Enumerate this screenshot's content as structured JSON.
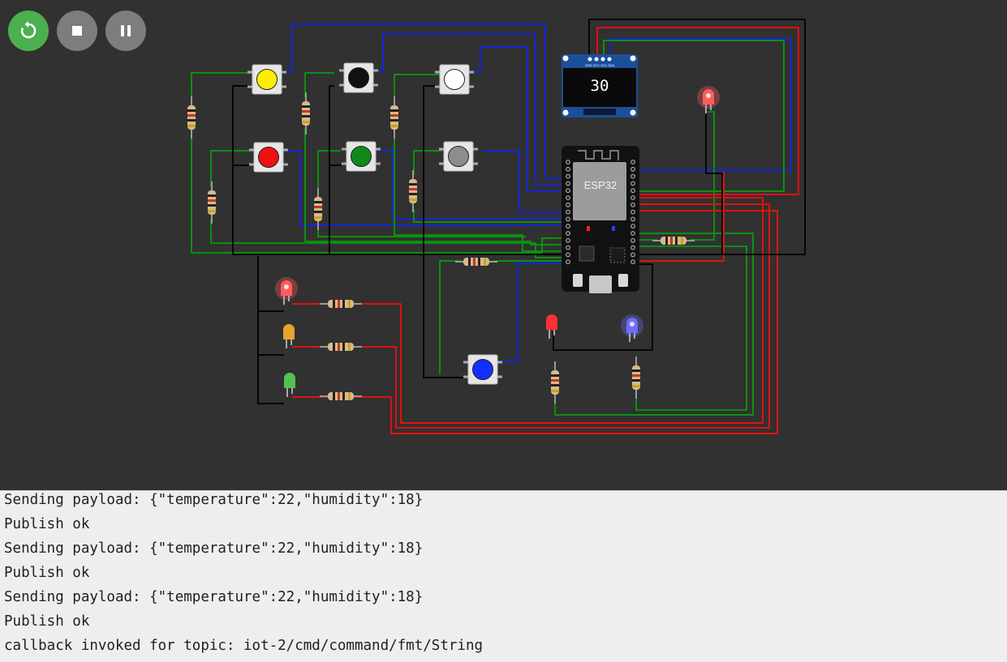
{
  "controls": {
    "restart_icon": "restart-icon",
    "stop_icon": "stop-icon",
    "pause_icon": "pause-icon",
    "restart_color": "#4caf50",
    "stop_color": "#7d7d7d",
    "pause_color": "#7d7d7d"
  },
  "simulation": {
    "board_label": "ESP32",
    "oled_value": "30",
    "oled_pin_labels": "GND VCC SCL SDA",
    "buttons": [
      {
        "name": "yellow",
        "color": "#ffee00"
      },
      {
        "name": "black",
        "color": "#111111"
      },
      {
        "name": "white",
        "color": "#ffffff"
      },
      {
        "name": "red",
        "color": "#ee1111"
      },
      {
        "name": "green",
        "color": "#0f8a1a"
      },
      {
        "name": "gray",
        "color": "#8d8d8d"
      },
      {
        "name": "blue",
        "color": "#1030ff"
      }
    ],
    "leds": [
      {
        "name": "red-top-right",
        "color": "#ff5b5b",
        "lit": true
      },
      {
        "name": "red-left",
        "color": "#ff5b5b",
        "lit": true
      },
      {
        "name": "orange-left",
        "color": "#e6a42a",
        "lit": false
      },
      {
        "name": "green-left",
        "color": "#54c154",
        "lit": false
      },
      {
        "name": "red-bottom",
        "color": "#ff3030",
        "lit": false
      },
      {
        "name": "blue-bottom",
        "color": "#6e6eff",
        "lit": true
      }
    ],
    "wire_colors": {
      "red": "#e01010",
      "blue": "#1226d8",
      "green": "#0c9010",
      "black": "#050505"
    }
  },
  "console": {
    "lines": [
      "Sending payload: {\"temperature\":22,\"humidity\":18}",
      "Publish ok",
      "Sending payload: {\"temperature\":22,\"humidity\":18}",
      "Publish ok",
      "Sending payload: {\"temperature\":22,\"humidity\":18}",
      "Publish ok",
      "callback invoked for topic: iot-2/cmd/command/fmt/String"
    ]
  }
}
